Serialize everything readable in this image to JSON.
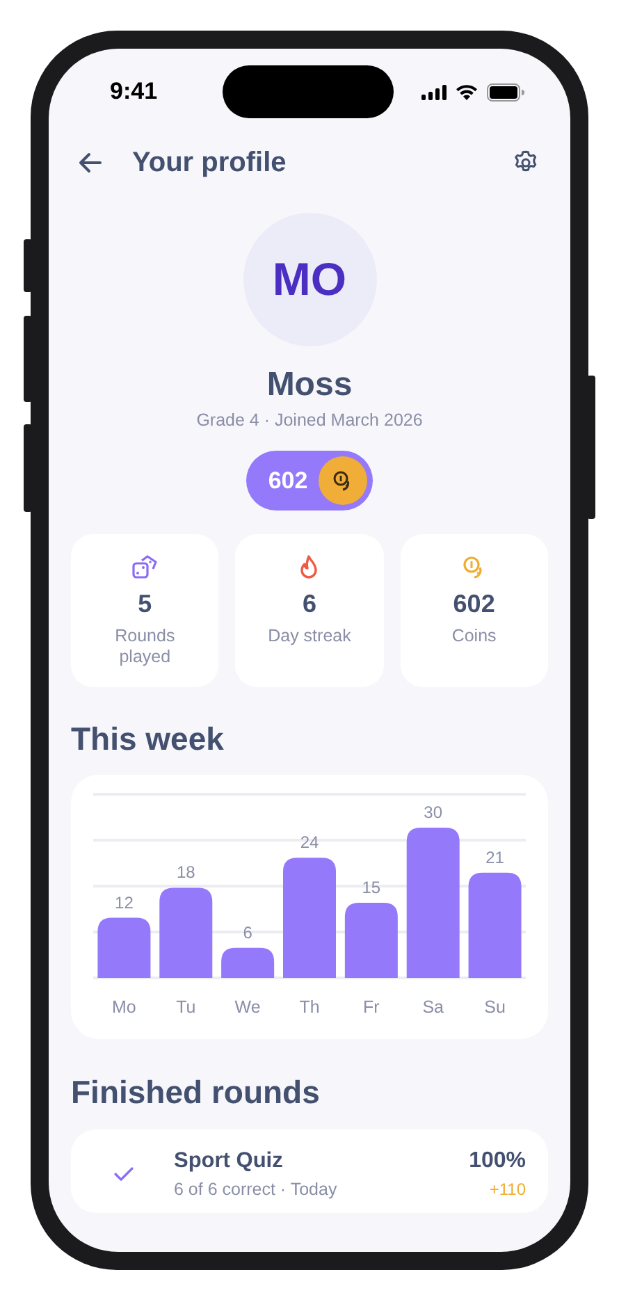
{
  "status_bar": {
    "time": "9:41"
  },
  "header": {
    "title": "Your profile"
  },
  "profile": {
    "initials": "MO",
    "name": "Moss",
    "subtitle": "Grade 4 · Joined March 2026",
    "coins": "602"
  },
  "stats": [
    {
      "kind": "dice",
      "value": "5",
      "label": "Rounds played",
      "color": "#8b6cf6"
    },
    {
      "kind": "flame",
      "value": "6",
      "label": "Day streak",
      "color": "#f05a44"
    },
    {
      "kind": "coins",
      "value": "602",
      "label": "Coins",
      "color": "#f0ad2e"
    }
  ],
  "week": {
    "title": "This week",
    "chart_data": {
      "type": "bar",
      "categories": [
        "Mo",
        "Tu",
        "We",
        "Th",
        "Fr",
        "Sa",
        "Su"
      ],
      "values": [
        12,
        18,
        6,
        24,
        15,
        30,
        21
      ],
      "data_labels": true
    }
  },
  "finished": {
    "title": "Finished rounds",
    "rounds": [
      {
        "title": "Sport Quiz",
        "detail": "6 of 6 correct · Today",
        "score": "100%",
        "reward": "+110"
      }
    ]
  }
}
